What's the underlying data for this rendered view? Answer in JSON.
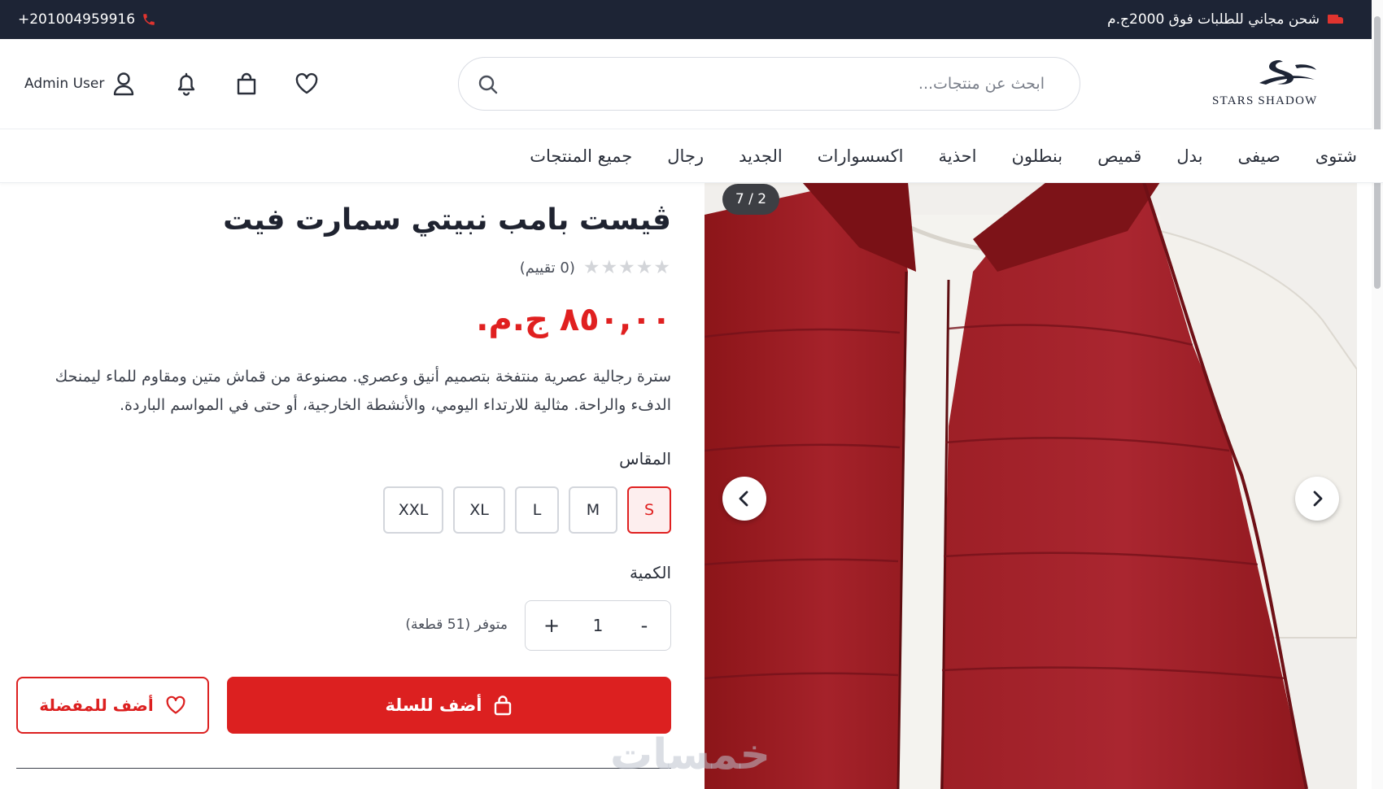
{
  "topbar": {
    "phone": "+201004959916",
    "promo": "شحن مجاني للطلبات فوق 2000ج.م"
  },
  "header": {
    "logo": "STARS SHADOW",
    "search_placeholder": "ابحث عن منتجات...",
    "user_name": "Admin User"
  },
  "nav": {
    "items": [
      "شتوى",
      "صيفى",
      "بدل",
      "قميص",
      "بنطلون",
      "احذية",
      "اكسسوارات",
      "الجديد",
      "رجال",
      "جميع المنتجات"
    ]
  },
  "gallery": {
    "counter": "7 / 2"
  },
  "product": {
    "title": "ڤيست بامب نبيتي سمارت فيت",
    "stars": "★★★★★",
    "rating_text": "(0 تقييم)",
    "price": "٨٥٠,٠٠ ج.م.",
    "description": "سترة رجالية عصرية منتفخة بتصميم أنيق وعصري. مصنوعة من قماش متين ومقاوم للماء ليمنحك الدفء والراحة. مثالية للارتداء اليومي، والأنشطة الخارجية، أو حتى في المواسم الباردة.",
    "size_label": "المقاس",
    "sizes": [
      "S",
      "M",
      "L",
      "XL",
      "XXL"
    ],
    "selected_size": "S",
    "quantity_label": "الكمية",
    "quantity": "1",
    "quantity_minus": "-",
    "quantity_plus": "+",
    "stock_text": "متوفر (51 قطعة)",
    "add_to_cart": "أضف للسلة",
    "add_to_wishlist": "أضف للمفضلة"
  },
  "watermark": "خمسات",
  "colors": {
    "accent": "#dc2020",
    "topbar_bg": "#1d2435",
    "vest": "#a01e24"
  }
}
